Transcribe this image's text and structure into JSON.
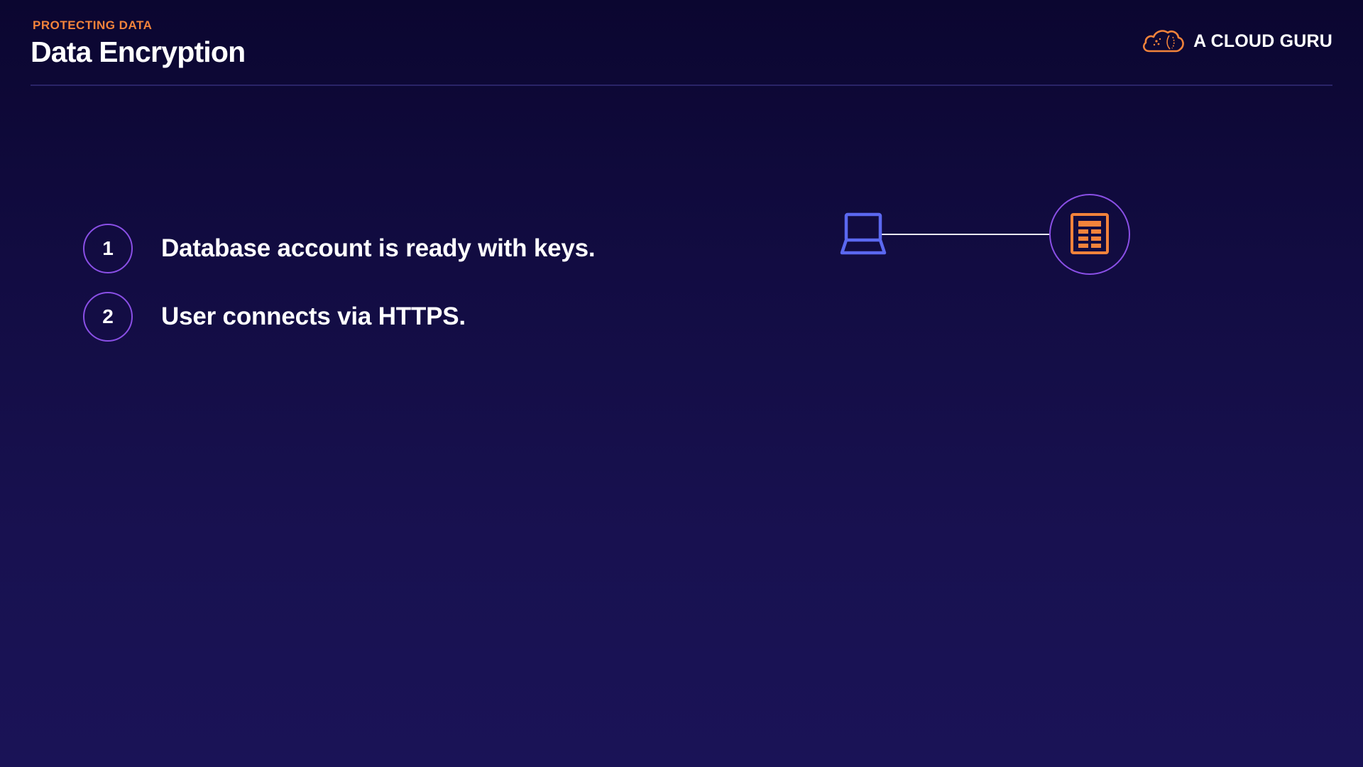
{
  "header": {
    "eyebrow": "PROTECTING DATA",
    "title": "Data Encryption"
  },
  "brand": {
    "name": "A CLOUD GURU",
    "icon": "cloud-icon",
    "color": "#f2833b"
  },
  "steps": [
    {
      "number": "1",
      "text": "Database account is ready with keys."
    },
    {
      "number": "2",
      "text": "User connects via HTTPS."
    }
  ],
  "diagram": {
    "client_icon": "laptop-icon",
    "server_icon": "database-table-icon",
    "client_color": "#5b68f0",
    "server_color": "#f2833b",
    "ring_color": "#8a4fe6",
    "link_color": "#e8e8f0"
  }
}
